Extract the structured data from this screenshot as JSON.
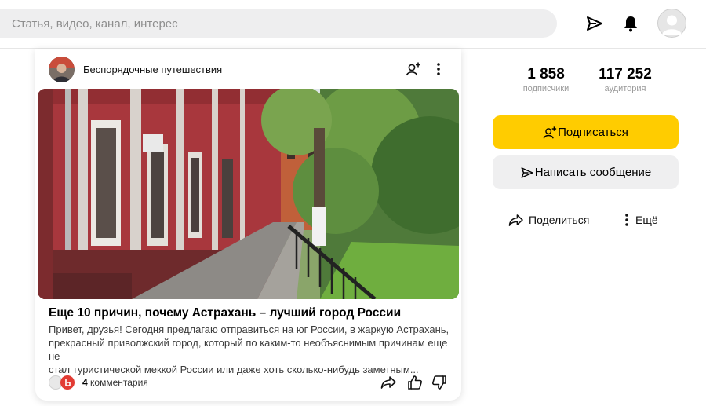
{
  "search": {
    "placeholder": "Статья, видео, канал, интерес"
  },
  "header": {
    "icons": [
      "send-icon",
      "bell-icon",
      "user-avatar-icon"
    ]
  },
  "post": {
    "channel_name": "Беспорядочные путешествия",
    "title": "Еще 10 причин, почему Астрахань – лучший город России",
    "snippet_lines": [
      "Привет, друзья! Сегодня предлагаю отправиться на юг России, в жаркую Астрахань,",
      "прекрасный приволжский город, который по каким-то необъяснимым причинам еще не",
      "стал туристической меккой России или даже хоть сколько-нибудь заметным..."
    ],
    "comments_count": "4",
    "comments_label": "комментария"
  },
  "stats": {
    "subscribers_value": "1 858",
    "subscribers_label": "подписчики",
    "audience_value": "117 252",
    "audience_label": "аудитория"
  },
  "actions": {
    "subscribe_label": "Подписаться",
    "message_label": "Написать сообщение",
    "share_label": "Поделиться",
    "more_label": "Ещё"
  },
  "colors": {
    "accent_yellow": "#ffcc00",
    "search_bg": "#eeeeef",
    "secondary_button_bg": "#efeff0"
  }
}
